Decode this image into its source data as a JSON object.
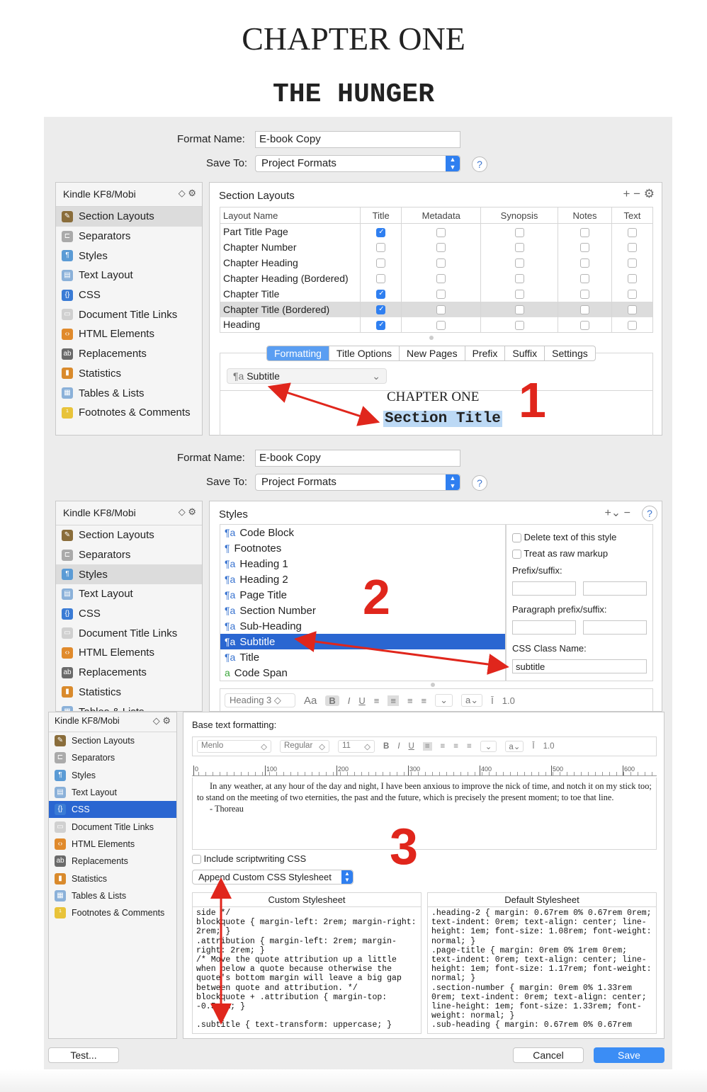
{
  "header": {
    "chapter": "CHAPTER ONE",
    "title": "THE HUNGER"
  },
  "form": {
    "format_name_label": "Format Name:",
    "format_name_value": "E-book Copy",
    "save_to_label": "Save To:",
    "save_to_value": "Project Formats",
    "help": "?"
  },
  "sidebar": {
    "format": "Kindle KF8/Mobi",
    "ctl": "◇ ⚙",
    "items": [
      "Section Layouts",
      "Separators",
      "Styles",
      "Text Layout",
      "CSS",
      "Document Title Links",
      "HTML Elements",
      "Replacements",
      "Statistics",
      "Tables & Lists",
      "Footnotes & Comments"
    ],
    "partial_item": "Tables & Lists"
  },
  "panel1": {
    "title": "Section Layouts",
    "toolbar": "+   −   ⚙",
    "columns": [
      "Layout Name",
      "Title",
      "Metadata",
      "Synopsis",
      "Notes",
      "Text"
    ],
    "rows": [
      {
        "name": "Part Title Page",
        "checks": [
          true,
          false,
          false,
          false,
          false
        ]
      },
      {
        "name": "Chapter Number",
        "checks": [
          false,
          false,
          false,
          false,
          false
        ]
      },
      {
        "name": "Chapter Heading",
        "checks": [
          false,
          false,
          false,
          false,
          false
        ]
      },
      {
        "name": "Chapter Heading (Bordered)",
        "checks": [
          false,
          false,
          false,
          false,
          false
        ]
      },
      {
        "name": "Chapter Title",
        "checks": [
          true,
          false,
          false,
          false,
          false
        ]
      },
      {
        "name": "Chapter Title (Bordered)",
        "checks": [
          true,
          false,
          false,
          false,
          false
        ]
      },
      {
        "name": "Heading",
        "checks": [
          true,
          false,
          false,
          false,
          false
        ]
      }
    ],
    "tabs": [
      "Formatting",
      "Title Options",
      "New Pages",
      "Prefix",
      "Suffix",
      "Settings"
    ],
    "style_select": "Subtitle",
    "preview_chapter": "CHAPTER ONE",
    "preview_title": "Section Title",
    "marker": "1"
  },
  "panel2": {
    "title": "Styles",
    "toolbar": "+⌄   −",
    "styles": [
      "Code Block",
      "Footnotes",
      "Heading 1",
      "Heading 2",
      "Page Title",
      "Section Number",
      "Sub-Heading",
      "Subtitle",
      "Title",
      "Code Span"
    ],
    "delete_text": "Delete text of this style",
    "raw_markup": "Treat as raw markup",
    "prefix_suffix": "Prefix/suffix:",
    "para_prefix_suffix": "Paragraph prefix/suffix:",
    "css_class_label": "CSS Class Name:",
    "css_class_value": "subtitle",
    "marker": "2",
    "toolbar2": {
      "style": "Heading 3",
      "aa": "Aa",
      "b": "B",
      "i": "I",
      "u": "U",
      "a": "a⌄",
      "spacing": "1.0"
    }
  },
  "panel3": {
    "base_label": "Base text formatting:",
    "font": "Menlo",
    "weight": "Regular",
    "size": "11",
    "b": "B",
    "i": "I",
    "u": "U",
    "a": "a⌄",
    "spacing": "1.0",
    "ruler": [
      "0",
      "100",
      "200",
      "300",
      "400",
      "500",
      "600"
    ],
    "quote": "In any weather, at any hour of the day and night, I have been anxious to improve the nick of time, and notch it on my stick too; to stand on the meeting of two eternities, the past and the future, which is precisely the present moment; to toe that line.",
    "attribution": "- Thoreau",
    "include_scriptwriting": "Include scriptwriting CSS",
    "append_css": "Append Custom CSS Stylesheet",
    "custom_title": "Custom Stylesheet",
    "custom_css": "side */\nblockquote { margin-left: 2rem; margin-right: 2rem; }\n.attribution { margin-left: 2rem; margin-right: 2rem; }\n/* Move the quote attribution up a little when below a quote because otherwise the quote's bottom margin will leave a big gap between quote and attribution. */\nblockquote + .attribution { margin-top: -0.5rem; }\n\n.subtitle { text-transform: uppercase; }",
    "default_title": "Default Stylesheet",
    "default_css": ".heading-2 { margin: 0.67rem 0% 0.67rem 0rem; text-indent: 0rem; text-align: center; line-height: 1em; font-size: 1.08rem; font-weight: normal; }\n.page-title { margin: 0rem 0% 1rem 0rem; text-indent: 0rem; text-align: center; line-height: 1em; font-size: 1.17rem; font-weight: normal; }\n.section-number { margin: 0rem 0% 1.33rem 0rem; text-indent: 0rem; text-align: center; line-height: 1em; font-size: 1.33rem; font-weight: normal; }\n.sub-heading { margin: 0.67rem 0% 0.67rem",
    "marker": "3",
    "test": "Test...",
    "cancel": "Cancel",
    "save": "Save"
  },
  "colors": {
    "accent": "#2f7ff0",
    "selection": "#2a66d1",
    "annotation": "#e0261c"
  }
}
